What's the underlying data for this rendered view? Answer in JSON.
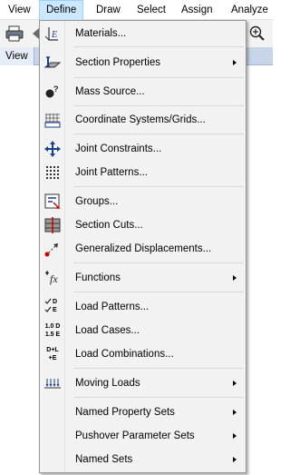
{
  "menubar": {
    "items": [
      "View",
      "Define",
      "Draw",
      "Select",
      "Assign",
      "Analyze"
    ]
  },
  "view_tab": {
    "label": "View"
  },
  "menu": {
    "materials": "Materials...",
    "section_properties": "Section Properties",
    "mass_source": "Mass Source...",
    "coordinate_systems": "Coordinate Systems/Grids...",
    "joint_constraints": "Joint Constraints...",
    "joint_patterns": "Joint Patterns...",
    "groups": "Groups...",
    "section_cuts": "Section Cuts...",
    "generalized_displacements": "Generalized Displacements...",
    "functions": "Functions",
    "load_patterns": "Load Patterns...",
    "load_cases": "Load Cases...",
    "load_combinations": "Load Combinations...",
    "moving_loads": "Moving Loads",
    "named_property_sets": "Named Property Sets",
    "pushover_parameter_sets": "Pushover Parameter Sets",
    "named_sets": "Named Sets"
  },
  "icon_text": {
    "load_patterns": [
      "D",
      "E"
    ],
    "load_cases": [
      "1.0 D",
      "1.5 E"
    ],
    "load_combinations": [
      "D+L",
      "+E"
    ],
    "functions": "fx"
  },
  "colors": {
    "menu_background": "#f2f2f2",
    "active_menu_highlight": "#cce8ff",
    "view_tab": "#c7d5e8"
  }
}
